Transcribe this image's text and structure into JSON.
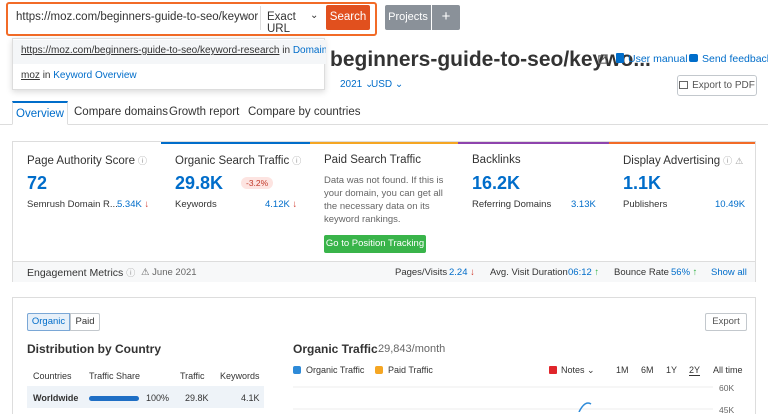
{
  "search": {
    "url": "https://moz.com/beginners-guide-to-seo/keyword-resear",
    "clear": "×",
    "scope": "Exact URL",
    "button": "Search"
  },
  "projects": {
    "label": "Projects",
    "plus": "+"
  },
  "dropdown": {
    "item1": {
      "url": "https://moz.com/beginners-guide-to-seo/keyword-research",
      "in": "in",
      "target": "Domain Ov..."
    },
    "item2": {
      "term": "moz",
      "in": "in",
      "target": "Keyword Overview"
    }
  },
  "header": {
    "title": "beginners-guide-to-seo/keywo...",
    "user_manual": "User manual",
    "send_feedback": "Send feedback",
    "date": "2021",
    "currency": "USD",
    "export_pdf": "Export to PDF"
  },
  "tabs": [
    "Overview",
    "Compare domains",
    "Growth report",
    "Compare by countries"
  ],
  "metrics": {
    "page_authority": {
      "title": "Page Authority Score",
      "value": "72",
      "sub_label": "Semrush Domain R...",
      "sub_value": "5.34K"
    },
    "organic": {
      "title": "Organic Search Traffic",
      "value": "29.8K",
      "change": "-3.2%",
      "sub_label": "Keywords",
      "sub_value": "4.12K"
    },
    "paid": {
      "title": "Paid Search Traffic",
      "text": "Data was not found. If this is your domain, you can get all the necessary data on its keyword rankings.",
      "button": "Go to Position Tracking"
    },
    "backlinks": {
      "title": "Backlinks",
      "value": "16.2K",
      "sub_label": "Referring Domains",
      "sub_value": "3.13K"
    },
    "display": {
      "title": "Display Advertising",
      "value": "1.1K",
      "sub_label": "Publishers",
      "sub_value": "10.49K"
    }
  },
  "engagement": {
    "label": "Engagement Metrics",
    "date": "June 2021",
    "pages_visit_label": "Pages/Visits",
    "pages_visit_value": "2.24",
    "duration_label": "Avg. Visit Duration",
    "duration_value": "06:12",
    "bounce_label": "Bounce Rate",
    "bounce_value": "56%",
    "show_all": "Show all"
  },
  "lower": {
    "organic_btn": "Organic",
    "paid_btn": "Paid",
    "export": "Export",
    "dist_title": "Distribution by Country",
    "cols": [
      "Countries",
      "Traffic Share",
      "Traffic",
      "Keywords"
    ],
    "row": {
      "country": "Worldwide",
      "share": "100%",
      "share_value": 1.0,
      "traffic": "29.8K",
      "keywords": "4.1K"
    },
    "org_title": "Organic Traffic",
    "org_sub": "29,843/month",
    "legend_organic": "Organic Traffic",
    "legend_paid": "Paid Traffic",
    "notes": "Notes",
    "ranges": [
      "1M",
      "6M",
      "1Y",
      "2Y",
      "All time"
    ],
    "y_ticks": [
      "60K",
      "45K"
    ]
  },
  "colors": {
    "accent": "#006dca",
    "search_button": "#e1501e",
    "highlight_border": "#f26b27",
    "green": "#39b44a",
    "organic_cb": "#2e8ad8",
    "paid_cb": "#f5a623"
  }
}
